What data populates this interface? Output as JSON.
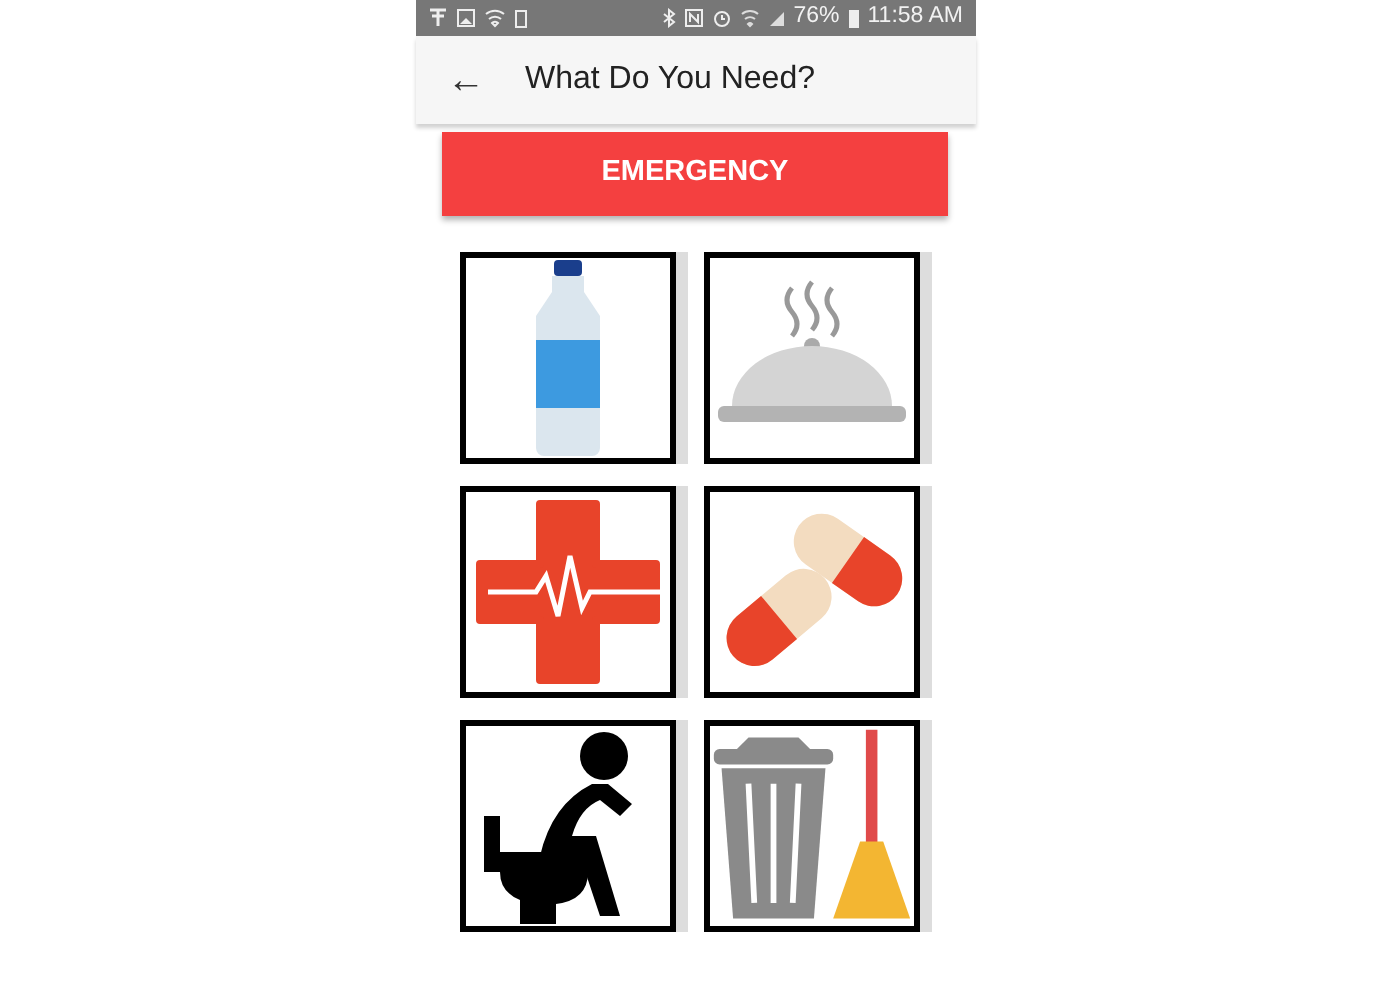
{
  "status_bar": {
    "battery": "76%",
    "time": "11:58 AM"
  },
  "app_bar": {
    "back": "←",
    "title": "What Do You Need?"
  },
  "emergency_button": {
    "label": "EMERGENCY"
  },
  "tiles": [
    {
      "kind": "water"
    },
    {
      "kind": "food"
    },
    {
      "kind": "medical"
    },
    {
      "kind": "medicine"
    },
    {
      "kind": "toilet"
    },
    {
      "kind": "cleaning"
    }
  ]
}
